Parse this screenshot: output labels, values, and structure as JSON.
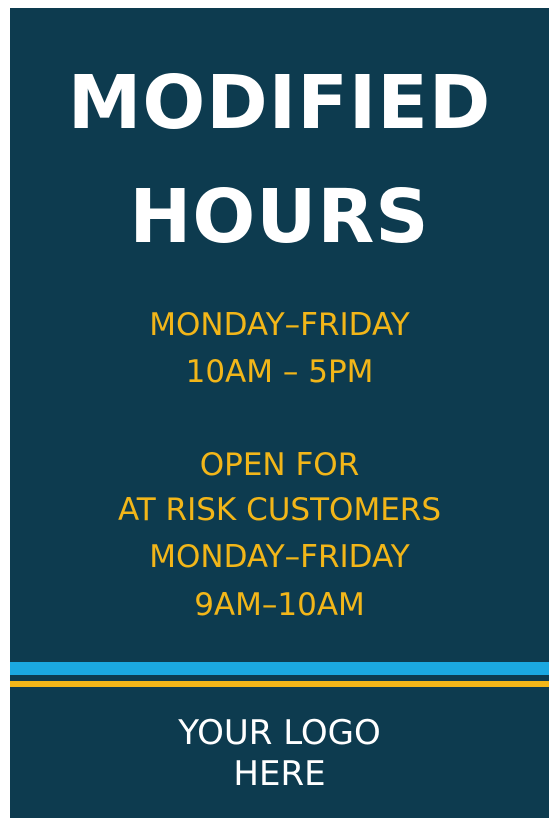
{
  "sign": {
    "title_line1": "MODIFIED",
    "title_line2": "HOURS",
    "regular_hours": {
      "days": "MONDAY–FRIDAY",
      "time": "10AM – 5PM"
    },
    "special_hours": {
      "line1": "OPEN FOR",
      "line2": "AT RISK CUSTOMERS",
      "days": "MONDAY–FRIDAY",
      "time": "9AM–10AM"
    },
    "logo_line1": "YOUR LOGO",
    "logo_line2": "HERE"
  },
  "colors": {
    "background": "#0d3b4f",
    "title": "#ffffff",
    "hours_text": "#f2b619",
    "stripe_blue": "#1ba8e0",
    "stripe_gold": "#f2b619"
  }
}
